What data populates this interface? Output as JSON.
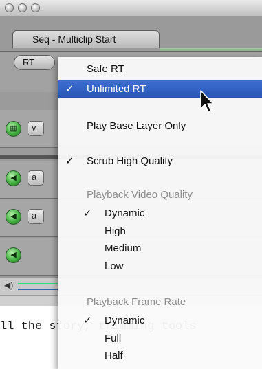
{
  "window": {
    "title_tab": "Seq - Multiclip Start",
    "rt_button": "RT",
    "tracks": [
      {
        "kind": "video",
        "btn": "v"
      },
      {
        "kind": "audio",
        "btn": "a"
      },
      {
        "kind": "audio",
        "btn": "a"
      }
    ]
  },
  "background_text": "ll the story, trimming tools",
  "menu": {
    "items": [
      {
        "id": "safe-rt",
        "label": "Safe RT",
        "checked": false,
        "highlighted": false,
        "disabled": false,
        "sub": false
      },
      {
        "id": "unlimited-rt",
        "label": "Unlimited RT",
        "checked": true,
        "highlighted": true,
        "disabled": false,
        "sub": false
      },
      {
        "id": "play-base-layer-only",
        "label": "Play Base Layer Only",
        "checked": false,
        "highlighted": false,
        "disabled": false,
        "sub": false
      },
      {
        "id": "scrub-high-quality",
        "label": "Scrub High Quality",
        "checked": true,
        "highlighted": false,
        "disabled": false,
        "sub": false
      },
      {
        "id": "playback-video-quality-header",
        "label": "Playback Video Quality",
        "checked": false,
        "highlighted": false,
        "disabled": true,
        "sub": false
      },
      {
        "id": "pvq-dynamic",
        "label": "Dynamic",
        "checked": true,
        "highlighted": false,
        "disabled": false,
        "sub": true
      },
      {
        "id": "pvq-high",
        "label": "High",
        "checked": false,
        "highlighted": false,
        "disabled": false,
        "sub": true
      },
      {
        "id": "pvq-medium",
        "label": "Medium",
        "checked": false,
        "highlighted": false,
        "disabled": false,
        "sub": true
      },
      {
        "id": "pvq-low",
        "label": "Low",
        "checked": false,
        "highlighted": false,
        "disabled": false,
        "sub": true
      },
      {
        "id": "playback-frame-rate-header",
        "label": "Playback Frame Rate",
        "checked": false,
        "highlighted": false,
        "disabled": true,
        "sub": false
      },
      {
        "id": "pfr-dynamic",
        "label": "Dynamic",
        "checked": true,
        "highlighted": false,
        "disabled": false,
        "sub": true
      },
      {
        "id": "pfr-full",
        "label": "Full",
        "checked": false,
        "highlighted": false,
        "disabled": false,
        "sub": true
      },
      {
        "id": "pfr-half",
        "label": "Half",
        "checked": false,
        "highlighted": false,
        "disabled": false,
        "sub": true
      }
    ],
    "check_glyph": "✓",
    "highlight_color": "#2f5fc4"
  }
}
